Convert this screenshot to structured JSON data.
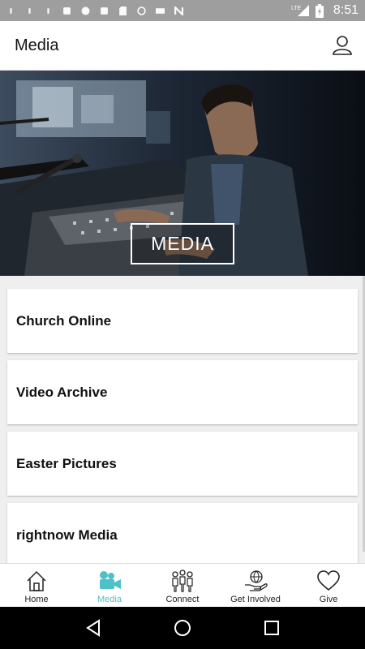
{
  "status_bar": {
    "time": "8:51",
    "network": "LTE",
    "icons": [
      "signal-icon",
      "signal-icon",
      "signal-icon",
      "notification-icon",
      "circle-icon",
      "notification-icon",
      "sd-card-icon",
      "sync-icon",
      "mail-icon",
      "n-icon",
      "lte-signal-icon",
      "battery-icon"
    ]
  },
  "header": {
    "title": "Media"
  },
  "hero": {
    "label": "MEDIA"
  },
  "list": {
    "items": [
      {
        "label": "Church Online"
      },
      {
        "label": "Video Archive"
      },
      {
        "label": "Easter Pictures"
      },
      {
        "label": "rightnow Media"
      }
    ]
  },
  "tabs": [
    {
      "label": "Home",
      "icon": "home-icon",
      "active": false
    },
    {
      "label": "Media",
      "icon": "video-camera-icon",
      "active": true
    },
    {
      "label": "Connect",
      "icon": "people-icon",
      "active": false
    },
    {
      "label": "Get Involved",
      "icon": "hand-globe-icon",
      "active": false
    },
    {
      "label": "Give",
      "icon": "heart-icon",
      "active": false
    }
  ],
  "colors": {
    "accent": "#4ec0c8",
    "status_bar": "#9e9e9e",
    "nav_bar": "#000000",
    "background": "#efefef"
  }
}
